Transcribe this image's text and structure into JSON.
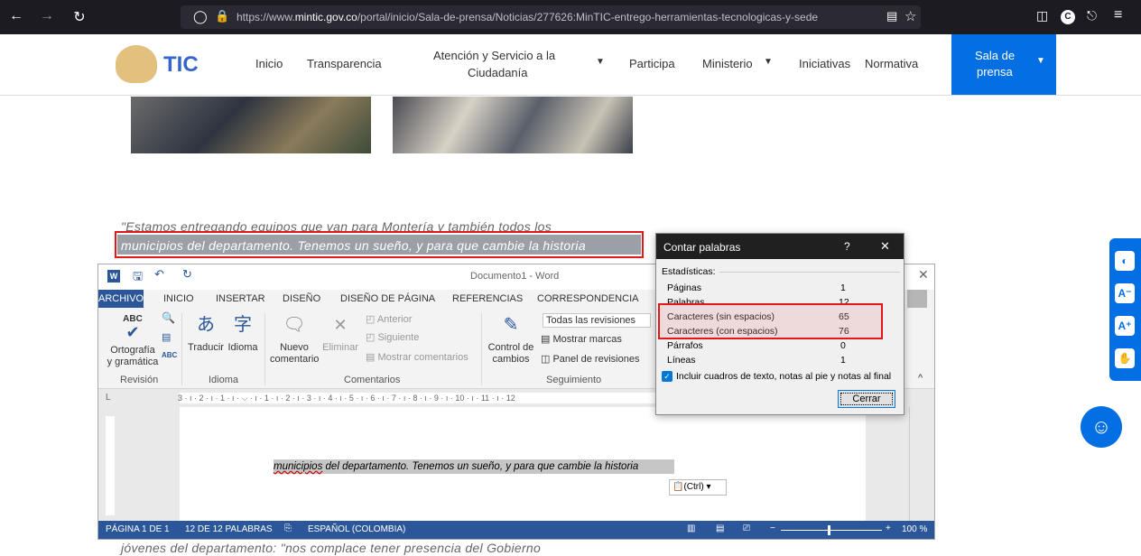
{
  "browser": {
    "url_pre": "https://www.",
    "url_domain": "mintic.gov.co",
    "url_post": "/portal/inicio/Sala-de-prensa/Noticias/277626:MinTIC-entrego-herramientas-tecnologicas-y-sede"
  },
  "site": {
    "logo_text": "TIC",
    "nav": [
      "Inicio",
      "Transparencia",
      "Atención y Servicio a la",
      "Ciudadanía",
      "Participa",
      "Ministerio",
      "Iniciativas",
      "Normativa"
    ],
    "sala_line1": "Sala de",
    "sala_line2": "prensa"
  },
  "article": {
    "line1": "\"Estamos entregando equipos que van para Montería y también todos los",
    "line2": "municipios del departamento. Tenemos un sueño, y para que cambie la historia",
    "bottom": "jóvenes del departamento: \"nos complace tener presencia del Gobierno"
  },
  "word": {
    "title": "Documento1 - Word",
    "tabs": [
      "ARCHIVO",
      "INICIO",
      "INSERTAR",
      "DISEÑO",
      "DISEÑO DE PÁGINA",
      "REFERENCIAS",
      "CORRESPONDENCIA"
    ],
    "ribbon": {
      "ortografia1": "Ortografía",
      "ortografia2": "y gramática",
      "traducir": "Traducir",
      "idioma": "Idioma",
      "nuevo1": "Nuevo",
      "nuevo2": "comentario",
      "eliminar": "Eliminar",
      "anterior": "Anterior",
      "siguiente": "Siguiente",
      "mostrar_com": "Mostrar comentarios",
      "control1": "Control de",
      "control2": "cambios",
      "todas": "Todas las revisiones",
      "marcas": "Mostrar marcas",
      "panel": "Panel de revisiones",
      "g_revision": "Revisión",
      "g_idioma": "Idioma",
      "g_comentarios": "Comentarios",
      "g_seguimiento": "Seguimiento"
    },
    "ruler": "3 · ı · 2 · ı · 1 · ı · ⌵ · ı · 1 · ı · 2 · ı · 3 · ı · 4 · ı · 5 · ı · 6 · ı · 7 · ı · 8 · ı · 9 · ı · 10 · ı · 11 · ı · 12",
    "selected_word": "municipios",
    "selected_rest": " del departamento. Tenemos un sueño, y para que cambie la historia",
    "paste": "(Ctrl)",
    "status": {
      "page": "PÁGINA 1 DE 1",
      "words": "12 DE 12 PALABRAS",
      "lang": "ESPAÑOL (COLOMBIA)",
      "zoom": "100 %"
    }
  },
  "dialog": {
    "title": "Contar palabras",
    "help": "?",
    "header": "Estadísticas:",
    "rows": [
      {
        "label": "Páginas",
        "value": "1"
      },
      {
        "label": "Palabras",
        "value": "12"
      },
      {
        "label": "Caracteres (sin espacios)",
        "value": "65"
      },
      {
        "label": "Caracteres (con espacios)",
        "value": "76"
      },
      {
        "label": "Párrafos",
        "value": "0"
      },
      {
        "label": "Líneas",
        "value": "1"
      }
    ],
    "checkbox": "Incluir cuadros de texto, notas al pie y notas al final",
    "button": "Cerrar"
  }
}
